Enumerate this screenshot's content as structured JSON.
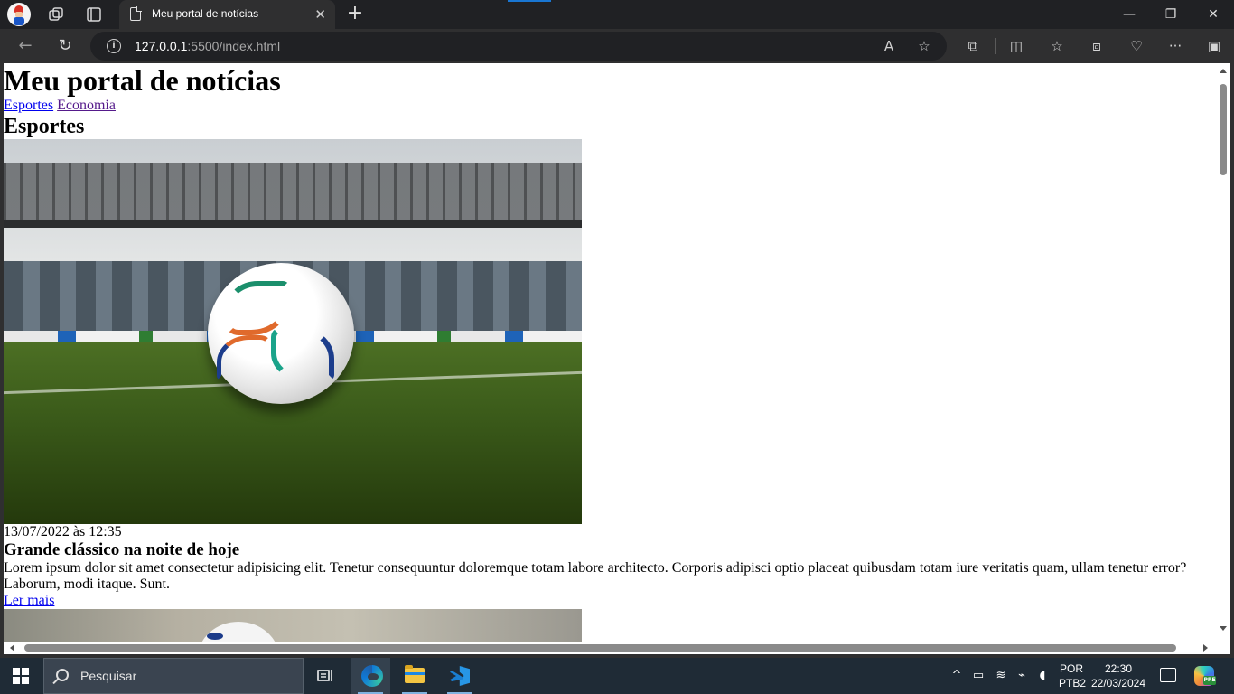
{
  "browser": {
    "tab": {
      "title": "Meu portal de notícias",
      "close": "✕"
    },
    "new_tab": "+",
    "window": {
      "minimize": "—",
      "restore": "❐",
      "close": "✕"
    },
    "address": {
      "host": "127.0.0.1",
      "path": ":5500/index.html"
    }
  },
  "page": {
    "title": "Meu portal de notícias",
    "nav": [
      {
        "label": "Esportes"
      },
      {
        "label": "Economia"
      }
    ],
    "section_title": "Esportes",
    "articles": [
      {
        "date": "13/07/2022 às 12:35",
        "headline": "Grande clássico na noite de hoje",
        "body": "Lorem ipsum dolor sit amet consectetur adipisicing elit. Tenetur consequuntur doloremque totam labore architecto. Corporis adipisci optio placeat quibusdam totam iure veritatis quam, ullam tenetur error? Laborum, modi itaque. Sunt.",
        "link": "Ler mais"
      }
    ]
  },
  "taskbar": {
    "search_placeholder": "Pesquisar",
    "language": {
      "line1": "POR",
      "line2": "PTB2"
    },
    "clock": {
      "time": "22:30",
      "date": "22/03/2024"
    },
    "copilot_badge": "PRE"
  },
  "colors": {
    "link": "#0000ee",
    "visited_link": "#551a8b",
    "browser_chrome": "#2f2f30",
    "taskbar": "#1f2b36"
  }
}
